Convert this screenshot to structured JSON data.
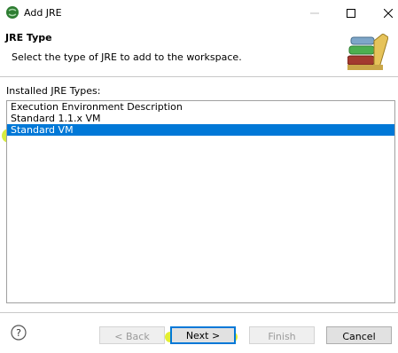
{
  "window": {
    "title": "Add JRE"
  },
  "header": {
    "title": "JRE Type",
    "description": "Select the type of JRE to add to the workspace."
  },
  "installed": {
    "label": "Installed JRE Types:",
    "items": [
      {
        "label": "Execution Environment Description",
        "selected": false
      },
      {
        "label": "Standard 1.1.x VM",
        "selected": false
      },
      {
        "label": "Standard VM",
        "selected": true
      }
    ]
  },
  "footer": {
    "back_label": "< Back",
    "next_label": "Next >",
    "finish_label": "Finish",
    "cancel_label": "Cancel",
    "help_icon": "help-icon"
  },
  "colors": {
    "selection": "#0078d7",
    "highlighter": "#c8e600"
  }
}
